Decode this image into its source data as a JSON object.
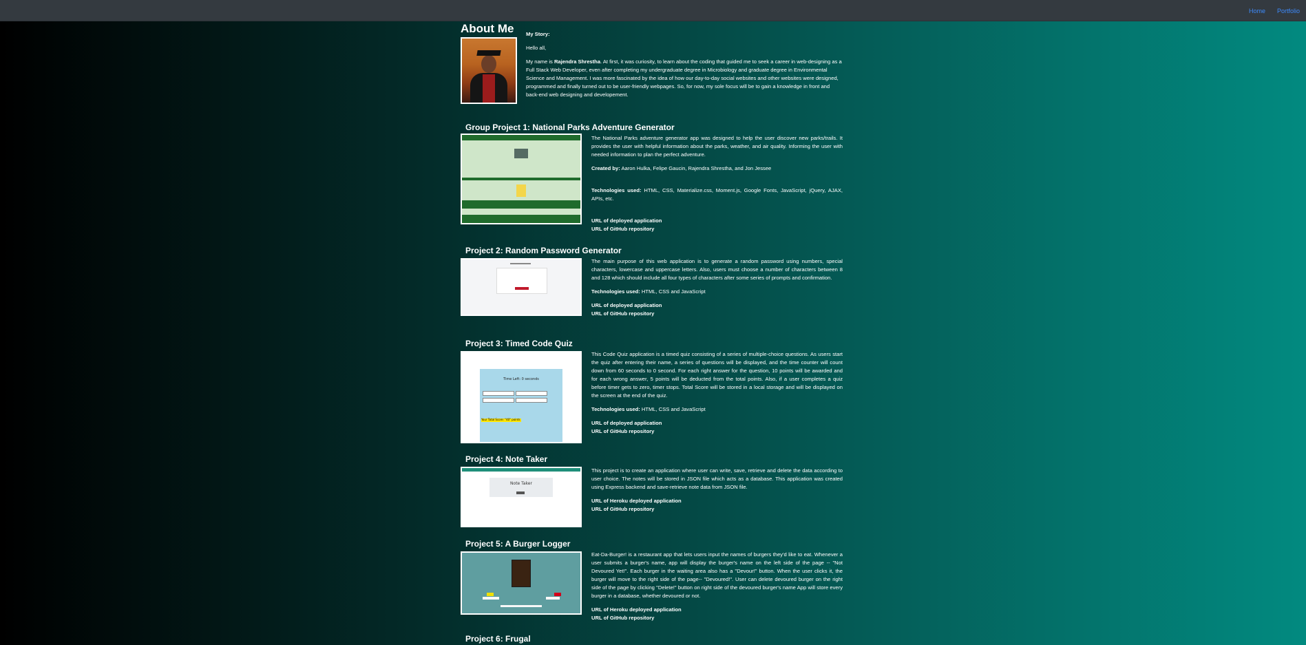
{
  "nav": {
    "home": "Home",
    "portfolio": "Portfolio"
  },
  "about": {
    "title": "About Me",
    "story_heading": "My Story:",
    "greeting": "Hello all,",
    "intro_prefix": "My name is ",
    "name": "Rajendra Shrestha",
    "intro_rest": ". At first, it was curiosity, to learn about the coding that guided me to seek a career in web-designing as a Full Stack Web Developer, even after completing my undergraduate degree in Microbiology and graduate degree in Environmental Science and Management. I was more fascinated by the idea of how our day-to-day social websites and other websites were designed, programmed and finally turned out to be user-friendly webpages. So, for now, my sole focus will be to gain a knowledge in front and back-end web designing and developement."
  },
  "projects": [
    {
      "title": "Group Project 1: National Parks Adventure Generator",
      "description": "The National Parks adventure generator app was designed to help the user discover new parks/trails. It provides the user with helpful information about the parks, weather, and air quality. Informing the user with needed information to plan the perfect adventure.",
      "created_label": "Created by:",
      "created_value": " Aaron Hulka, Felipe Gaucin, Rajendra Shrestha, and Jon Jessee",
      "tech_label": "Technologies used:",
      "tech_value": " HTML, CSS, Materialize.css, Moment.js, Google Fonts, JavaScript, jQuery, AJAX, APIs, etc.",
      "link_deployed": "URL of deployed application",
      "link_repo": "URL of GitHub repository"
    },
    {
      "title": "Project 2: Random Password Generator",
      "description": "The main purpose of this web application is to generate a random password using numbers, special characters, lowercase and uppercase letters. Also, users must choose a number of characters between 8 and 128 which should include all four types of characters after some series of prompts and confirmation.",
      "tech_label": "Technologies used:",
      "tech_value": " HTML, CSS and JavaScript",
      "link_deployed": "URL of deployed application",
      "link_repo": "URL of GitHub repository"
    },
    {
      "title": "Project 3: Timed Code Quiz",
      "description": "This Code Quiz application is a timed quiz consisting of a series of multiple-choice questions. As users start the quiz after entering their name, a series of questions will be displayed, and the time counter will count down from 60 seconds to 0 second. For each right answer for the question, 10 points will be awarded and for each wrong answer, 5 points will be deducted from the total points. Also, if a user completes a quiz before timer gets to zero, timer stops. Total Score will be stored in a local storage and will be displayed on the screen at the end of the quiz.",
      "tech_label": "Technologies used:",
      "tech_value": " HTML, CSS and JavaScript",
      "link_deployed": "URL of deployed application",
      "link_repo": "URL of GitHub repository"
    },
    {
      "title": "Project 4: Note Taker",
      "description": "This project is to create an application where user can write, save, retrieve and delete the data according to user choice. The notes will be stored in JSON file which acts as a database. This application was created using Express backend and save-retrieve note data from JSON file.",
      "link_deployed": "URL of Heroku deployed application",
      "link_repo": "URL of GitHub repository"
    },
    {
      "title": "Project 5: A Burger Logger",
      "description": "Eat-Da-Burger! is a restaurant app that lets users input the names of burgers they'd like to eat. Whenever a user submits a burger's name, app will display the burger's name on the left side of the page -- \"Not Devoured Yet!\". Each burger in the waiting area also has a \"Devour!\" button. When the user clicks it, the burger will move to the right side of the page-- \"Devoured!\". User can delete devoured burger on the right side of the page by clicking \"Delete!\" button on right side of the devoured burger's name App will store every burger in a database, whether devoured or not.",
      "link_deployed": "URL of Heroku deployed application",
      "link_repo": "URL of GitHub repository"
    },
    {
      "title": "Project 6: Frugal"
    }
  ],
  "screenshots": {
    "p3_timer": "Time Left: 0 seconds",
    "p3_score": "Your Total Score: \"40\" points",
    "p4_title": "Note Taker"
  }
}
